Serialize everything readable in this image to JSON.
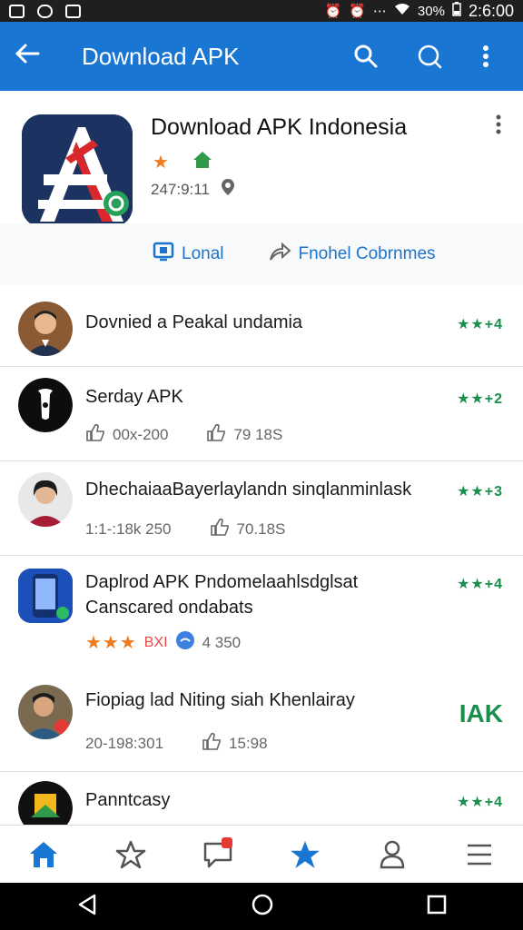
{
  "status_bar": {
    "battery": "30%",
    "time": "2:6:00"
  },
  "app_bar": {
    "title": "Download APK"
  },
  "header": {
    "app_name": "Download APK Indonesia",
    "meta": "247:9:11",
    "action_one": "Lonal",
    "action_two": "Fnohel Cobrnmes"
  },
  "items": [
    {
      "title": "Dovnied a Peakal undamia",
      "rating": "★★+4"
    },
    {
      "title": "Serday APK",
      "rating": "★★+2",
      "stat1": "00x-200",
      "stat2": "79 18S"
    },
    {
      "title": "DhechaiaaBayerlaylandn sinqlanminlask",
      "rating": "★★+3",
      "stat1": "1:1-:18k 250",
      "stat2": "70.18S"
    },
    {
      "title": "Daplrod APK Pndomelaahlsdglsat",
      "subtitle": "Canscared ondabats",
      "rating": "★★+4",
      "tag": "BXI",
      "stat2": "4 350"
    },
    {
      "title": "Fiopiag lad Niting siah Khenlairay",
      "badge": "IAK",
      "stat1": "20-198:301",
      "stat2": "15:98"
    },
    {
      "title": "Panntcasy",
      "rating": "★★+4"
    }
  ]
}
